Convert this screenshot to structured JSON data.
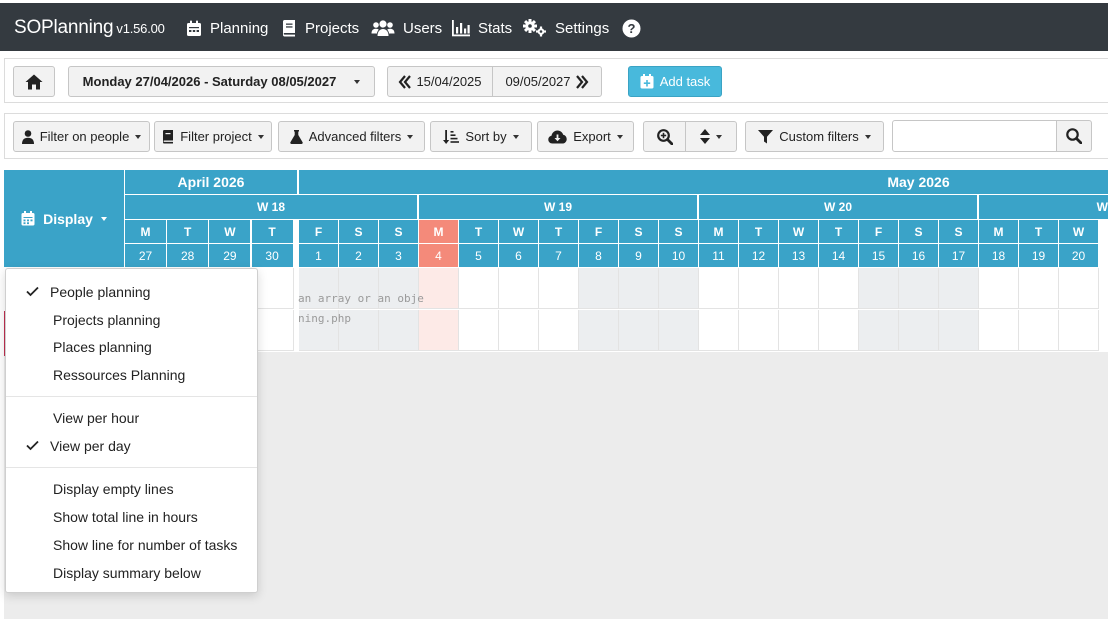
{
  "app": {
    "name": "SOPlanning",
    "version": "v1.56.00"
  },
  "nav": {
    "planning": "Planning",
    "projects": "Projects",
    "users": "Users",
    "stats": "Stats",
    "settings": "Settings"
  },
  "toolbar": {
    "date_range": "Monday 27/04/2026 - Saturday 08/05/2027",
    "prev_date": "15/04/2025",
    "next_date": "09/05/2027",
    "add_task": "Add task"
  },
  "filters": {
    "people": "Filter on people",
    "project": "Filter project",
    "advanced": "Advanced filters",
    "sort": "Sort by",
    "export": "Export",
    "custom": "Custom filters",
    "search_value": ""
  },
  "calendar": {
    "display_label": "Display",
    "months": [
      "April 2026",
      "May 2026"
    ],
    "weeks": [
      "W 18",
      "W 19",
      "W 20",
      "W"
    ],
    "day_letters": [
      "M",
      "T",
      "W",
      "T",
      "F",
      "S",
      "S",
      "M",
      "T",
      "W",
      "T",
      "F",
      "S",
      "S",
      "M",
      "T",
      "W",
      "T",
      "F",
      "S",
      "S",
      "M",
      "T",
      "W"
    ],
    "day_numbers": [
      "27",
      "28",
      "29",
      "30",
      "1",
      "2",
      "3",
      "4",
      "5",
      "6",
      "7",
      "8",
      "9",
      "10",
      "11",
      "12",
      "13",
      "14",
      "15",
      "16",
      "17",
      "18",
      "19",
      "20"
    ],
    "today_index": 7,
    "weekend_indices": [
      4,
      5,
      6,
      11,
      12,
      13,
      18,
      19,
      20
    ],
    "error_line_1": "an array or an obje",
    "error_line_2": "ning.php"
  },
  "display_menu": {
    "items": [
      {
        "label": "People planning",
        "checked": true
      },
      {
        "label": "Projects planning",
        "checked": false
      },
      {
        "label": "Places planning",
        "checked": false
      },
      {
        "label": "Ressources Planning",
        "checked": false
      },
      {
        "label": "View per hour",
        "checked": false
      },
      {
        "label": "View per day",
        "checked": true
      },
      {
        "label": "Display empty lines",
        "checked": false
      },
      {
        "label": "Show total line in hours",
        "checked": false
      },
      {
        "label": "Show line for number of tasks",
        "checked": false
      },
      {
        "label": "Display summary below",
        "checked": false
      }
    ]
  },
  "colors": {
    "navbar": "#343a40",
    "header_blue": "#3aa3c8",
    "today": "#f48a7a",
    "primary_button": "#48b9dc"
  }
}
